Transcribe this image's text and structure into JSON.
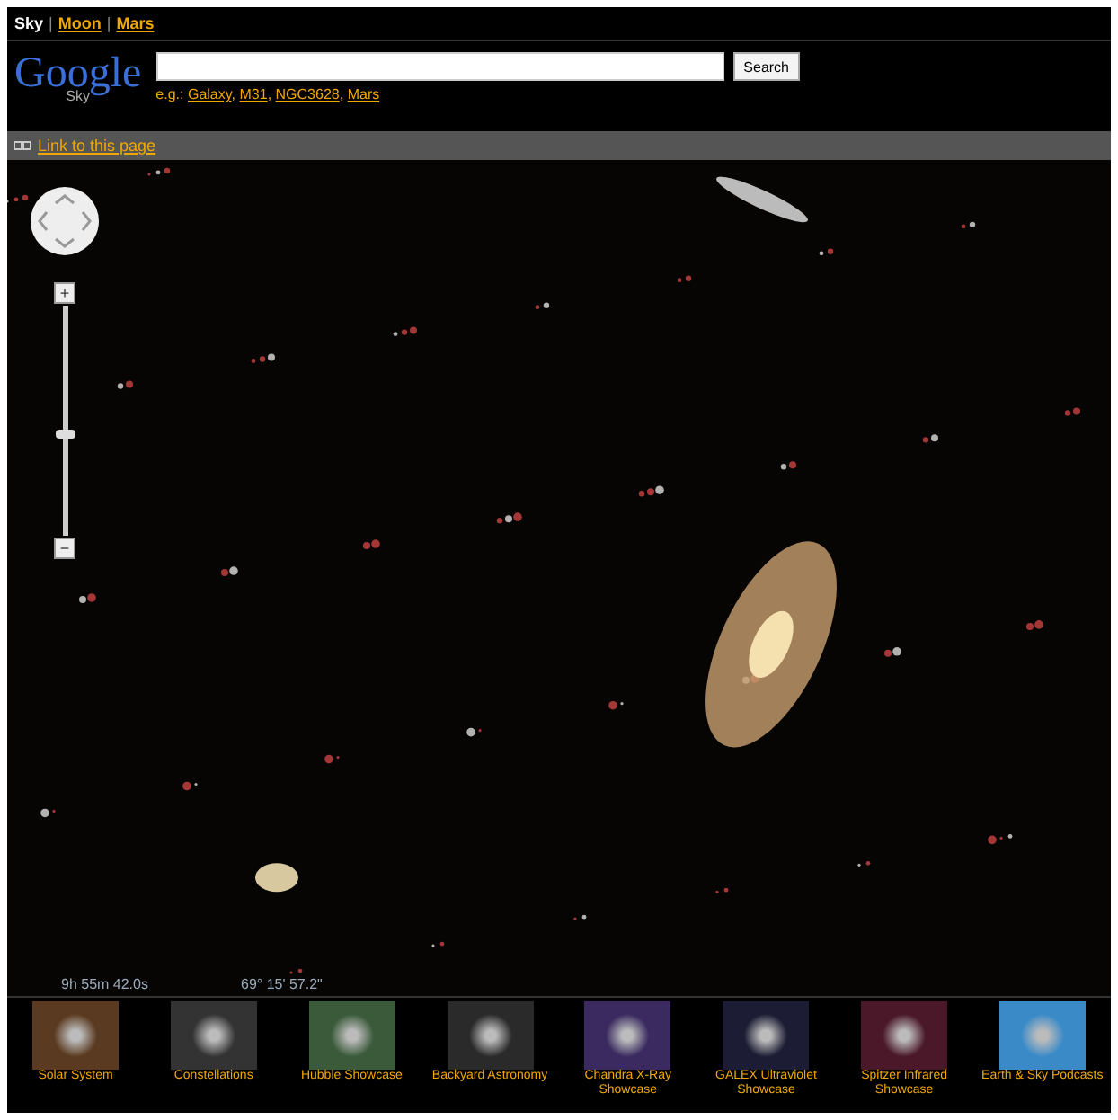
{
  "nav": [
    {
      "label": "Sky",
      "selected": true
    },
    {
      "label": "Moon",
      "selected": false
    },
    {
      "label": "Mars",
      "selected": false
    }
  ],
  "nav_separator": "|",
  "logo": {
    "text": "Google",
    "sub": "Sky"
  },
  "search": {
    "button": "Search",
    "examples_prefix": "e.g.:",
    "examples": [
      "Galaxy",
      "M31",
      "NGC3628",
      "Mars"
    ],
    "examples_separator": ","
  },
  "link_bar": {
    "label": "Link to this page"
  },
  "map": {
    "zoom": {
      "plus": "+",
      "minus": "−",
      "level": 0.44
    },
    "ra": "9h 55m 42.0s",
    "dec": "69° 15' 57.2\""
  },
  "gallery": [
    {
      "label": "Solar System"
    },
    {
      "label": "Constellations"
    },
    {
      "label": "Hubble Showcase"
    },
    {
      "label": "Backyard Astronomy"
    },
    {
      "label": "Chandra X-Ray Showcase"
    },
    {
      "label": "GALEX Ultraviolet Showcase"
    },
    {
      "label": "Spitzer Infrared Showcase"
    },
    {
      "label": "Earth & Sky Podcasts"
    }
  ]
}
